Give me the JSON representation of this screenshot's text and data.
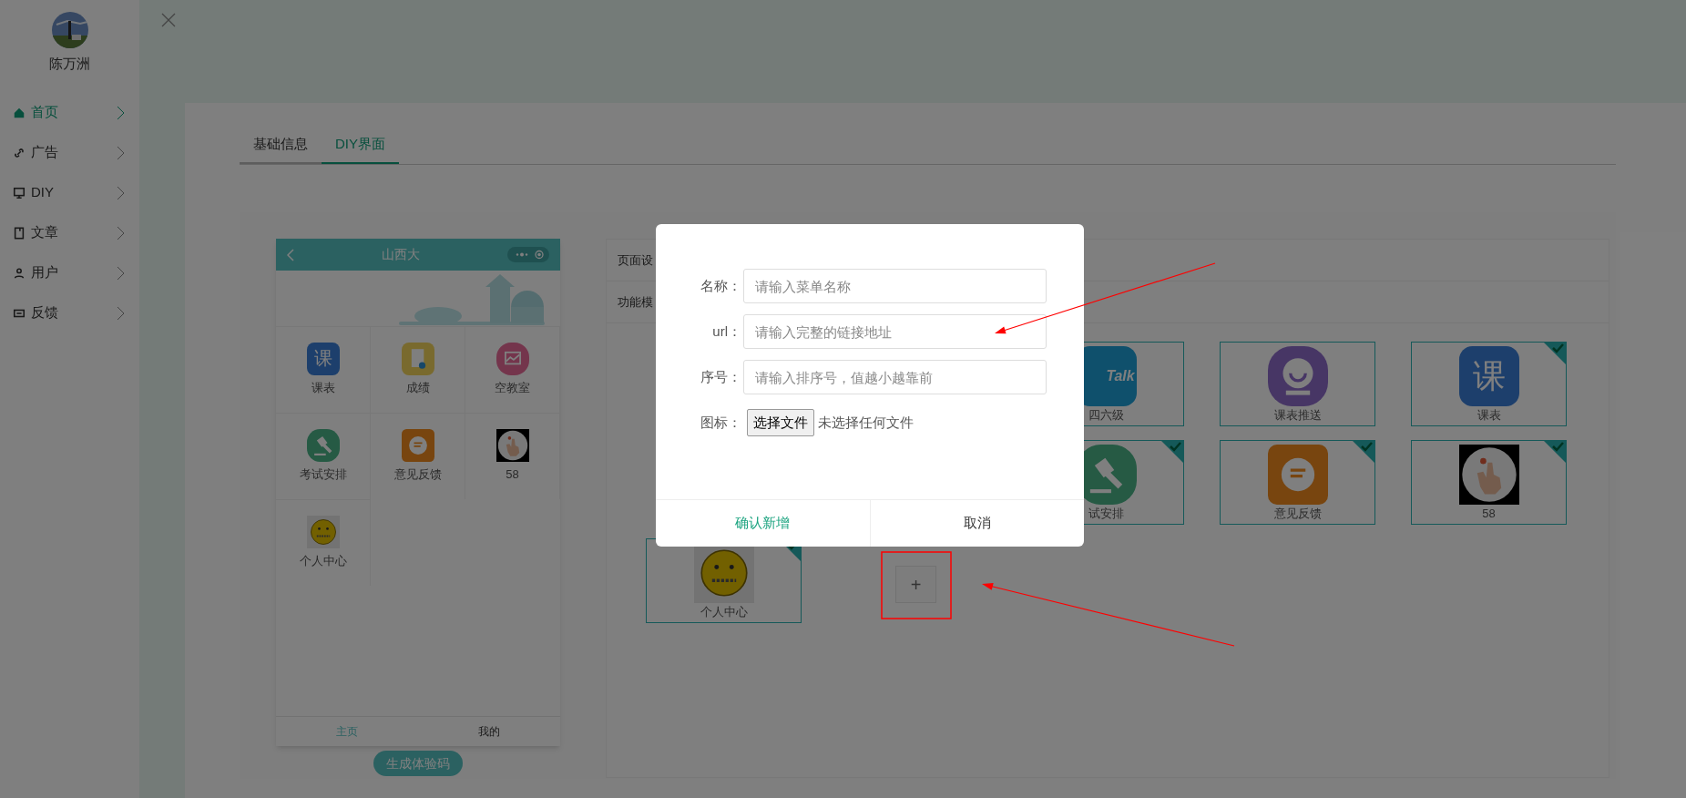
{
  "sidebar": {
    "user_name": "陈万洲",
    "items": [
      {
        "label": "首页",
        "kind": "home",
        "selected": true
      },
      {
        "label": "广告",
        "kind": "link",
        "selected": false
      },
      {
        "label": "DIY",
        "kind": "monitor",
        "selected": false
      },
      {
        "label": "文章",
        "kind": "book",
        "selected": false
      },
      {
        "label": "用户",
        "kind": "user",
        "selected": false
      },
      {
        "label": "反馈",
        "kind": "card",
        "selected": false
      }
    ]
  },
  "tabs": [
    {
      "label": "基础信息",
      "selected": false
    },
    {
      "label": "DIY界面",
      "selected": true
    }
  ],
  "phone": {
    "title": "山西大",
    "grid": [
      {
        "label": "课表",
        "kind": "text",
        "glyph": "课"
      },
      {
        "label": "成绩",
        "kind": "doc"
      },
      {
        "label": "空教室",
        "kind": "chart"
      },
      {
        "label": "考试安排",
        "kind": "gavel"
      },
      {
        "label": "意见反馈",
        "kind": "chat"
      },
      {
        "label": "58",
        "kind": "hand"
      },
      {
        "label": "个人中心",
        "kind": "face"
      }
    ],
    "tab_bar": [
      {
        "label": "主页",
        "selected": true
      },
      {
        "label": "我的",
        "selected": false
      }
    ],
    "qr_button": "生成体验码"
  },
  "sections": [
    "页面设",
    "功能模"
  ],
  "tile_rows": [
    {
      "tiles": [
        {
          "label": "四六级",
          "kind": "talk",
          "glyph": "Talk",
          "checked": false
        },
        {
          "label": "课表推送",
          "kind": "camera",
          "checked": false
        },
        {
          "label": "课表",
          "kind": "text",
          "glyph": "课",
          "checked": true
        }
      ]
    },
    {
      "tiles": [
        {
          "label": "试安排",
          "kind": "gavel",
          "checked": true
        },
        {
          "label": "意见反馈",
          "kind": "chat",
          "checked": true
        },
        {
          "label": "58",
          "kind": "hand",
          "checked": true
        }
      ]
    },
    {
      "tiles": [
        {
          "label": "个人中心",
          "kind": "face",
          "checked": true
        }
      ],
      "add_button": "+"
    }
  ],
  "dialog": {
    "fields": [
      {
        "kind": "input",
        "label": "名称：",
        "placeholder": "请输入菜单名称"
      },
      {
        "kind": "input",
        "label": "url：",
        "placeholder": "请输入完整的链接地址"
      },
      {
        "kind": "input",
        "label": "序号：",
        "placeholder": "请输入排序号，值越小越靠前"
      },
      {
        "kind": "file",
        "label": "图标：",
        "button": "选择文件",
        "status": "未选择任何文件"
      }
    ],
    "confirm": "确认新增",
    "cancel": "取消"
  }
}
